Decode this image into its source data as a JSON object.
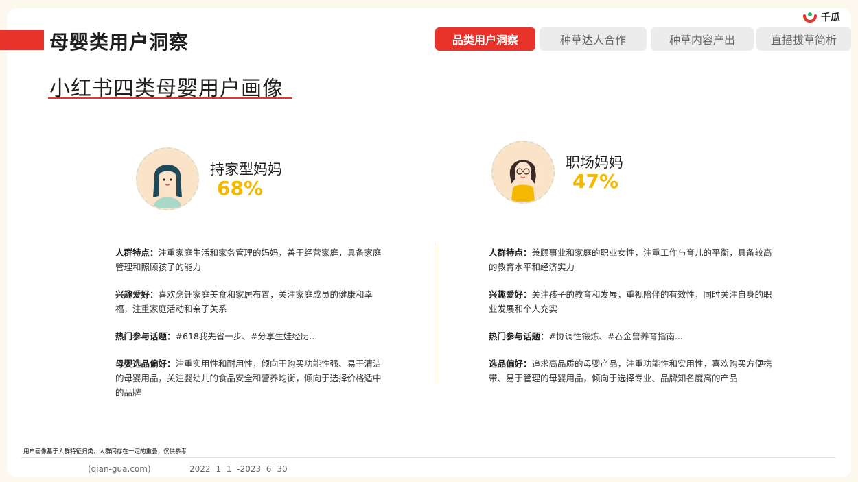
{
  "header": {
    "title": "母婴类用户洞察",
    "logo_text": "千瓜",
    "tabs": [
      {
        "label": "品类用户洞察",
        "active": true
      },
      {
        "label": "种草达人合作",
        "active": false
      },
      {
        "label": "种草内容产出",
        "active": false
      },
      {
        "label": "直播拔草简析",
        "active": false
      }
    ]
  },
  "main": {
    "subtitle": "小红书四类母婴用户画像",
    "personas": [
      {
        "name": "持家型妈妈",
        "percent": "68%",
        "avatar_icon": "mom-long-hair-avatar",
        "attributes": [
          {
            "key": "人群特点：",
            "value": "注重家庭生活和家务管理的妈妈，善于经营家庭，具备家庭管理和照顾孩子的能力"
          },
          {
            "key": "兴趣爱好：",
            "value": "喜欢烹饪家庭美食和家居布置，关注家庭成员的健康和幸福，注重家庭活动和亲子关系"
          },
          {
            "key": "热门参与话题：",
            "value": "#618我先省一步、#分享生娃经历..."
          },
          {
            "key": "母婴选品偏好：",
            "value": "注重实用性和耐用性，倾向于购买功能性强、易于清洁的母婴用品，关注婴幼儿的食品安全和营养均衡，倾向于选择价格适中的品牌"
          }
        ]
      },
      {
        "name": "职场妈妈",
        "percent": "47%",
        "avatar_icon": "mom-glasses-peace-sign-avatar",
        "attributes": [
          {
            "key": "人群特点：",
            "value": "兼顾事业和家庭的职业女性，注重工作与育儿的平衡，具备较高的教育水平和经济实力"
          },
          {
            "key": "兴趣爱好：",
            "value": "关注孩子的教育和发展，重视陪伴的有效性，同时关注自身的职业发展和个人充实"
          },
          {
            "key": "热门参与话题：",
            "value": "#协调性锻炼、#吞金兽养育指南..."
          },
          {
            "key": "选品偏好：",
            "value": "追求高品质的母婴产品，注重功能性和实用性，喜欢购买方便携带、易于管理的母婴用品，倾向于选择专业、品牌知名度高的产品"
          }
        ]
      }
    ]
  },
  "footer": {
    "note": "用户画像基于人群特征归类，人群间存在一定的重叠，仅供参考",
    "source": "(qian-gua.com)",
    "date_range": "2022 1 1 -2023 6 30"
  },
  "colors": {
    "brand_red": "#e8332a",
    "percent_yellow": "#f5b800",
    "tab_inactive": "#ececec"
  }
}
